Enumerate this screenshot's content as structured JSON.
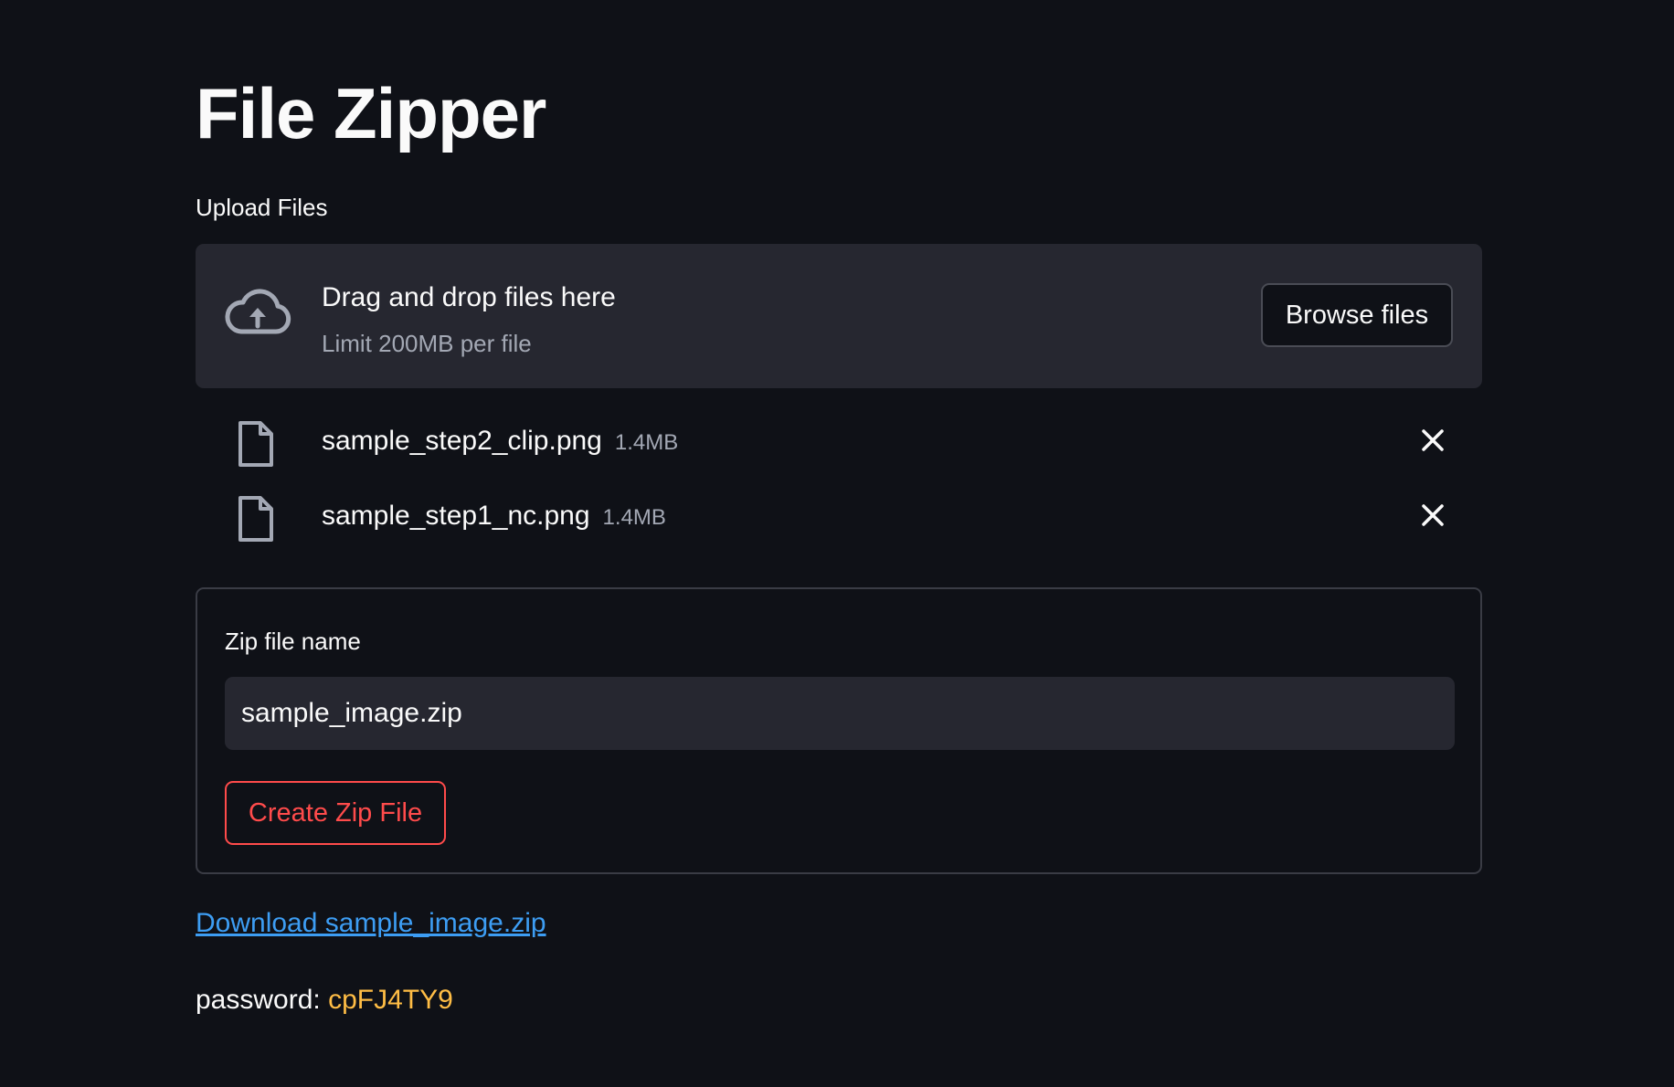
{
  "page": {
    "title": "File Zipper"
  },
  "uploader": {
    "label": "Upload Files",
    "drop_title": "Drag and drop files here",
    "drop_limit": "Limit 200MB per file",
    "browse_label": "Browse files",
    "icon": "cloud-upload-icon"
  },
  "files": [
    {
      "name": "sample_step2_clip.png",
      "size": "1.4MB",
      "icon": "file-icon"
    },
    {
      "name": "sample_step1_nc.png",
      "size": "1.4MB",
      "icon": "file-icon"
    }
  ],
  "form": {
    "zip_label": "Zip file name",
    "zip_value": "sample_image.zip",
    "create_label": "Create Zip File"
  },
  "result": {
    "download_label": "Download sample_image.zip",
    "password_label": "password:",
    "password_value": "cpFJ4TY9"
  },
  "colors": {
    "background": "#0f1117",
    "panel": "#262730",
    "accent_red": "#ff4b4b",
    "link_blue": "#3d9df3",
    "password_yellow": "#ffbd45",
    "muted_text": "#a3a8b4"
  }
}
